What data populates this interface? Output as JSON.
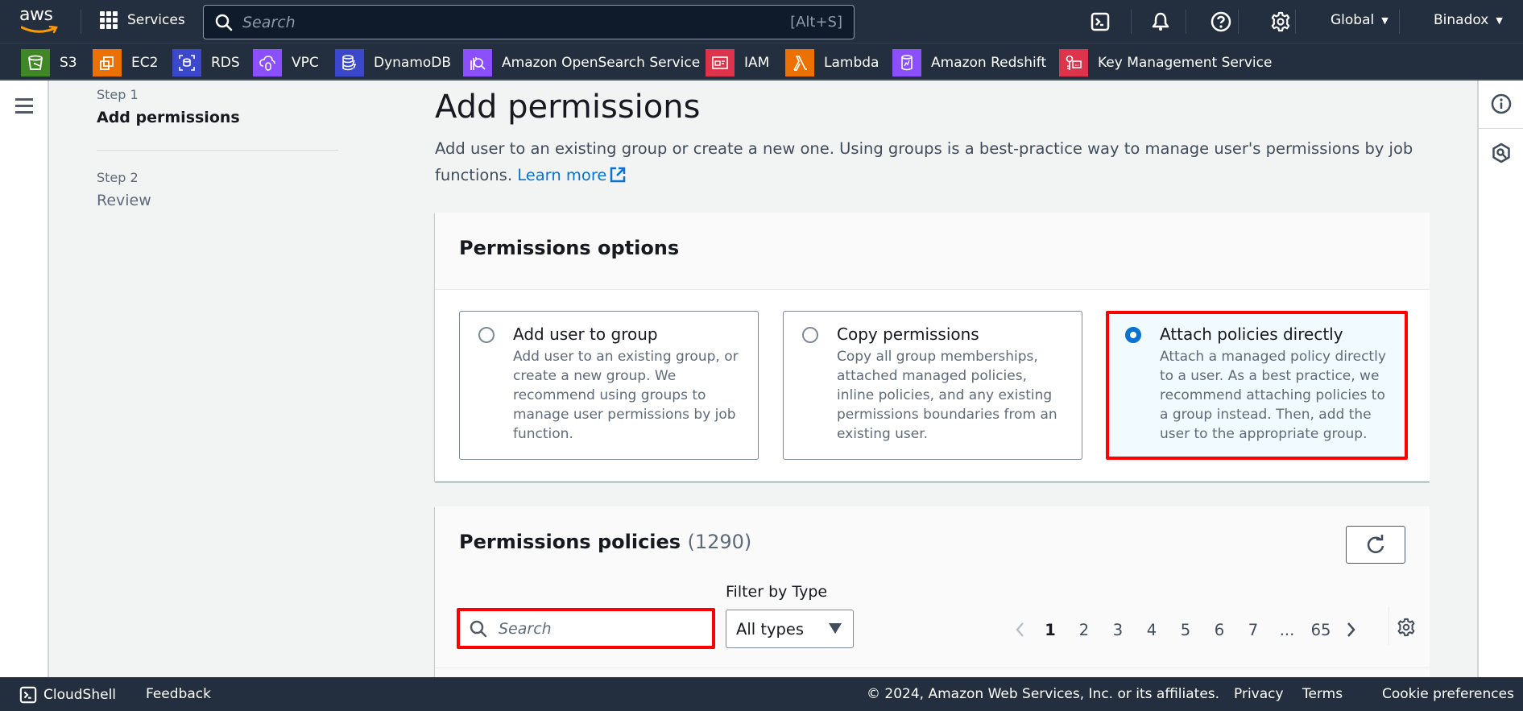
{
  "topnav": {
    "logo_text": "aws",
    "services_label": "Services",
    "search_placeholder": "Search",
    "search_shortcut": "[Alt+S]",
    "region_label": "Global",
    "account_label": "Binadox"
  },
  "favorites": [
    {
      "label": "S3",
      "icon": "s3-bucket-icon",
      "color": "#3f8624"
    },
    {
      "label": "EC2",
      "icon": "ec2-chip-icon",
      "color": "#ed7100"
    },
    {
      "label": "RDS",
      "icon": "rds-database-icon",
      "color": "#3b48cc"
    },
    {
      "label": "VPC",
      "icon": "vpc-cloud-icon",
      "color": "#8c4fff"
    },
    {
      "label": "DynamoDB",
      "icon": "dynamodb-icon",
      "color": "#3b48cc"
    },
    {
      "label": "Amazon OpenSearch Service",
      "icon": "opensearch-icon",
      "color": "#8c4fff"
    },
    {
      "label": "IAM",
      "icon": "iam-id-card-icon",
      "color": "#dd344c"
    },
    {
      "label": "Lambda",
      "icon": "lambda-icon",
      "color": "#ed7100"
    },
    {
      "label": "Amazon Redshift",
      "icon": "redshift-icon",
      "color": "#8c4fff"
    },
    {
      "label": "Key Management Service",
      "icon": "kms-key-icon",
      "color": "#dd344c"
    }
  ],
  "steps": [
    {
      "number": "Step 1",
      "title": "Add permissions",
      "active": true
    },
    {
      "number": "Step 2",
      "title": "Review",
      "active": false
    }
  ],
  "page": {
    "title": "Add permissions",
    "description": "Add user to an existing group or create a new one. Using groups is a best-practice way to manage user's permissions by job functions.",
    "learn_more": "Learn more"
  },
  "permissions_options": {
    "heading": "Permissions options",
    "options": [
      {
        "title": "Add user to group",
        "description": "Add user to an existing group, or create a new group. We recommend using groups to manage user permissions by job function.",
        "selected": false
      },
      {
        "title": "Copy permissions",
        "description": "Copy all group memberships, attached managed policies, inline policies, and any existing permissions boundaries from an existing user.",
        "selected": false
      },
      {
        "title": "Attach policies directly",
        "description": "Attach a managed policy directly to a user. As a best practice, we recommend attaching policies to a group instead. Then, add the user to the appropriate group.",
        "selected": true
      }
    ]
  },
  "policies": {
    "heading": "Permissions policies",
    "count": "(1290)",
    "search_placeholder": "Search",
    "filter_label": "Filter by Type",
    "filter_value": "All types",
    "pages": [
      "1",
      "2",
      "3",
      "4",
      "5",
      "6",
      "7",
      "...",
      "65"
    ],
    "current_page": "1"
  },
  "footer": {
    "cloudshell": "CloudShell",
    "feedback": "Feedback",
    "copyright": "© 2024, Amazon Web Services, Inc. or its affiliates.",
    "privacy": "Privacy",
    "terms": "Terms",
    "cookies": "Cookie preferences"
  },
  "colors": {
    "nav_bg": "#232f3e",
    "link": "#0972d3",
    "selected_bg": "#f1faff",
    "highlight": "#ff0000"
  }
}
